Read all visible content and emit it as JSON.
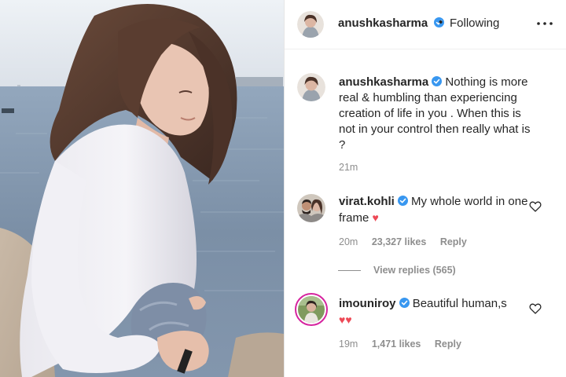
{
  "header": {
    "username": "anushkasharma",
    "separator": "•",
    "follow_status": "Following"
  },
  "caption": {
    "username": "anushkasharma",
    "text": "Nothing is more real & humbling than experiencing creation of life in you . When this is not in your control then really what is ?",
    "time": "21m"
  },
  "comments": [
    {
      "username": "virat.kohli",
      "text": "My whole world in one frame",
      "emoji": "♥",
      "time": "20m",
      "likes": "23,327 likes",
      "reply_label": "Reply",
      "view_replies": "View replies (565)"
    },
    {
      "username": "imouniroy",
      "text": "Beautiful human,s",
      "emoji": "♥♥",
      "time": "19m",
      "likes": "1,471 likes",
      "reply_label": "Reply"
    }
  ],
  "colors": {
    "verified": "#3897f0",
    "heart_red": "#ed4956",
    "muted_text": "#8e8e8e",
    "text": "#262626"
  },
  "icons": [
    "verified-icon",
    "more-options-icon",
    "heart-outline-icon"
  ]
}
